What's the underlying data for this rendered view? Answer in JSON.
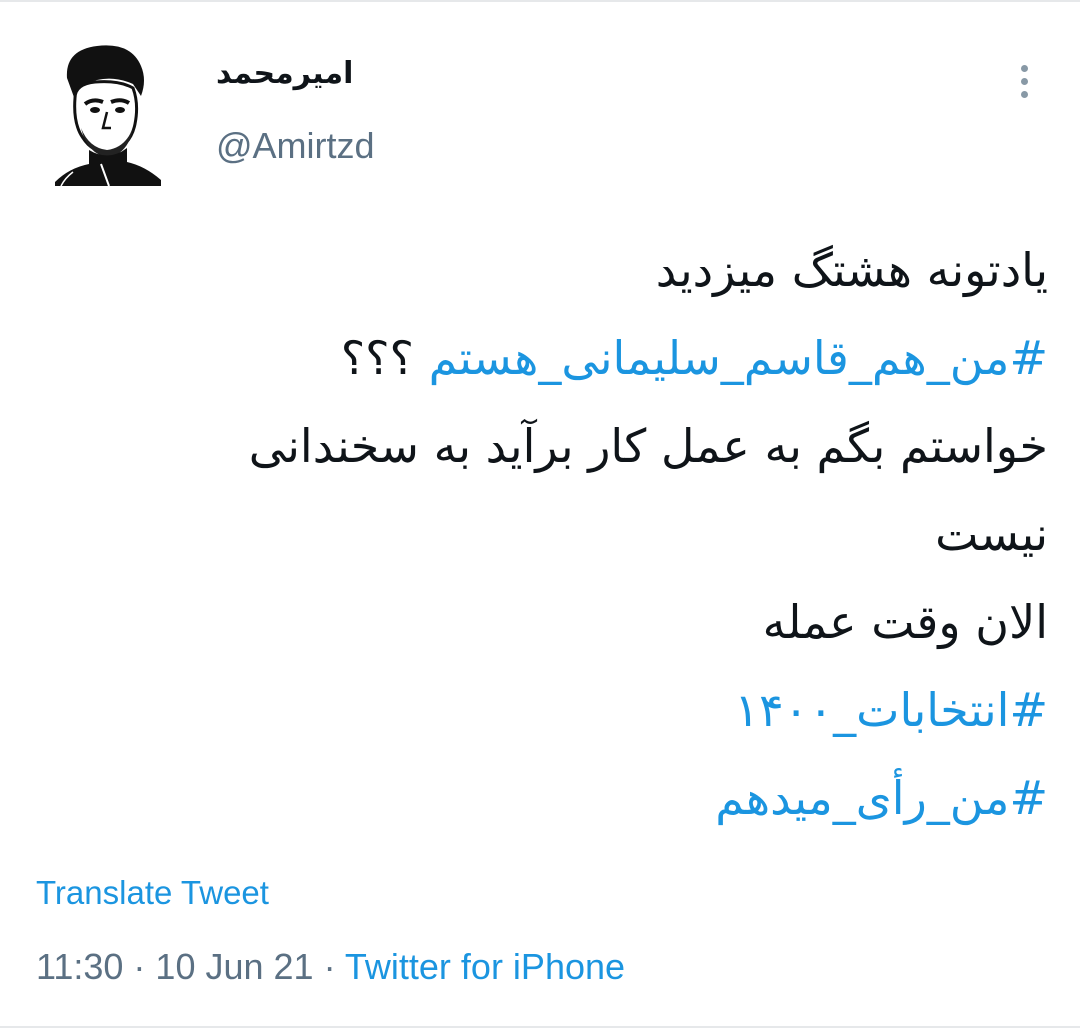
{
  "author": {
    "display_name": "امیرمحمد",
    "handle": "@Amirtzd"
  },
  "tweet": {
    "line1": "یادتونه هشتگ میزدید",
    "hashtag1": "#من_هم_قاسم_سلیمانی_هستم",
    "line2_suffix": " ؟؟؟",
    "line3": "خواستم بگم به عمل کار برآید به سخندانی",
    "line4": "نیست",
    "line5": "الان وقت عمله",
    "hashtag2": "#انتخابات_۱۴۰۰",
    "hashtag3": "#من_رأی_میدهم"
  },
  "translate_label": "Translate Tweet",
  "meta": {
    "time": "11:30",
    "separator1": " · ",
    "date": "10 Jun 21",
    "separator2": " · ",
    "source": "Twitter for iPhone"
  },
  "icons": {
    "more": "more-vertical-icon"
  },
  "colors": {
    "link": "#1b95e0",
    "secondary_text": "#5b7083",
    "primary_text": "#0f1419"
  }
}
